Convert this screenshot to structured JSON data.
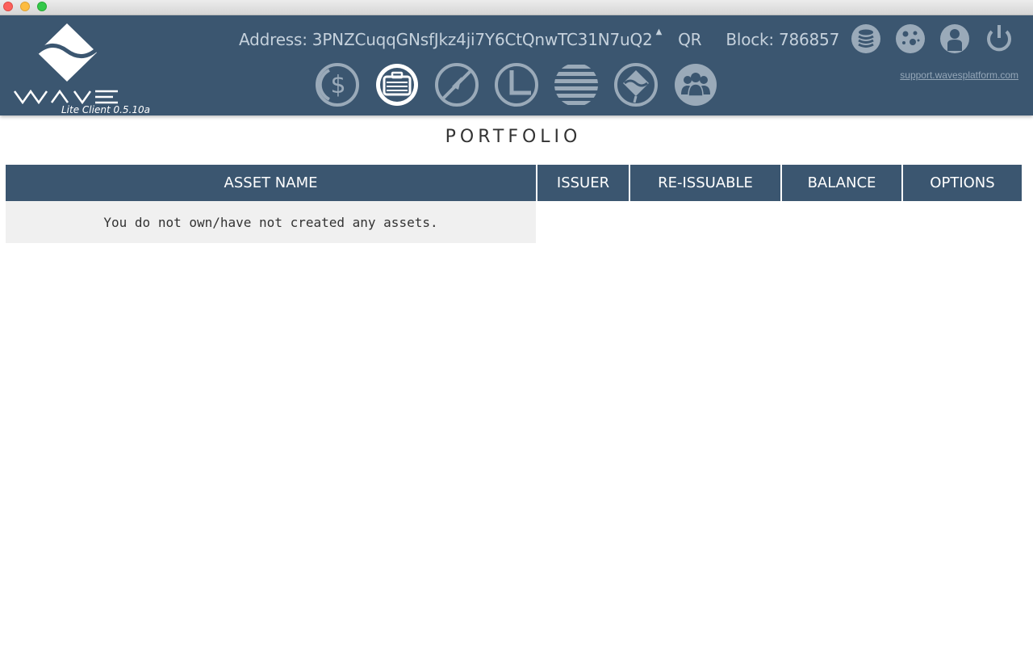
{
  "window": {
    "controls": [
      "close",
      "minimize",
      "maximize"
    ]
  },
  "header": {
    "logo_version": "Lite Client 0.5.10a",
    "address_label": "Address:",
    "address_value": "3PNZCuqqGNsfJkz4ji7Y6CtQnwTC31N7uQ2",
    "qr_label": "QR",
    "block_label": "Block:",
    "block_value": "786857",
    "support_link": "support.wavesplatform.com",
    "nav_icons": [
      "wallet-dollar-icon",
      "portfolio-briefcase-icon",
      "exchange-icon",
      "leasing-icon",
      "history-icon",
      "map-icon",
      "community-icon"
    ],
    "active_nav": "portfolio-briefcase-icon",
    "tool_icons": [
      "database-sync-icon",
      "settings-gear-icon",
      "account-user-icon",
      "power-icon"
    ]
  },
  "page": {
    "title": "PORTFOLIO"
  },
  "table": {
    "headers": [
      "ASSET NAME",
      "ISSUER",
      "RE-ISSUABLE",
      "BALANCE",
      "OPTIONS"
    ],
    "empty_message": "You do not own/have not created any assets."
  },
  "colors": {
    "header_bg": "#3b5670",
    "icon_gray": "#9aaab9",
    "row_bg": "#f0f0f0"
  }
}
